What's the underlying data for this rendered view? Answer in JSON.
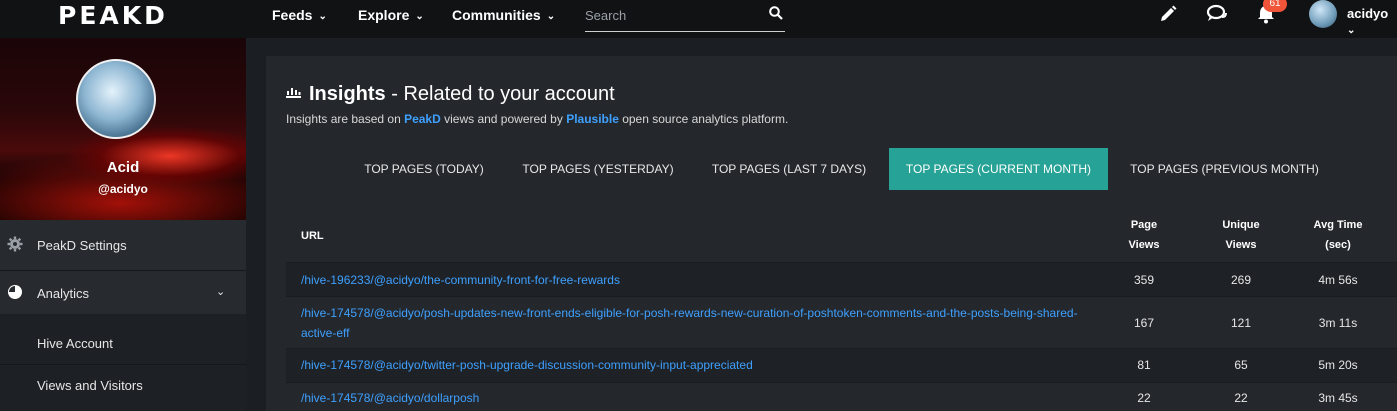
{
  "app": {
    "logo": "PEAKD"
  },
  "nav": {
    "feeds": "Feeds",
    "explore": "Explore",
    "communities": "Communities",
    "search_placeholder": "Search",
    "notifications_count": "61",
    "username": "acidyo"
  },
  "sidebar": {
    "display_name": "Acid",
    "handle": "@acidyo",
    "items": [
      {
        "label": "PeakD Settings",
        "icon": "gear-icon"
      },
      {
        "label": "Analytics",
        "icon": "pie-chart-icon"
      },
      {
        "label": "Hive Account"
      },
      {
        "label": "Views and Visitors"
      }
    ]
  },
  "insights": {
    "title_bold": "Insights",
    "title_rest": " - Related to your account",
    "subtitle_prefix": "Insights are based on ",
    "subtitle_link1": "PeakD",
    "subtitle_middle": " views and powered by ",
    "subtitle_link2": "Plausible",
    "subtitle_suffix": " open source analytics platform."
  },
  "tabs": [
    {
      "label": "TOP PAGES (TODAY)"
    },
    {
      "label": "TOP PAGES (YESTERDAY)"
    },
    {
      "label": "TOP PAGES (LAST 7 DAYS)"
    },
    {
      "label": "TOP PAGES (CURRENT MONTH)",
      "active": true
    },
    {
      "label": "TOP PAGES (PREVIOUS MONTH)"
    }
  ],
  "table": {
    "headers": {
      "url": "URL",
      "page_views_1": "Page",
      "page_views_2": "Views",
      "unique_views_1": "Unique",
      "unique_views_2": "Views",
      "avg_time_1": "Avg Time",
      "avg_time_2": "(sec)"
    },
    "rows": [
      {
        "url": "/hive-196233/@acidyo/the-community-front-for-free-rewards",
        "page_views": "359",
        "unique_views": "269",
        "avg_time": "4m 56s"
      },
      {
        "url": "/hive-174578/@acidyo/posh-updates-new-front-ends-eligible-for-posh-rewards-new-curation-of-poshtoken-comments-and-the-posts-being-shared-active-eff",
        "page_views": "167",
        "unique_views": "121",
        "avg_time": "3m 11s"
      },
      {
        "url": "/hive-174578/@acidyo/twitter-posh-upgrade-discussion-community-input-appreciated",
        "page_views": "81",
        "unique_views": "65",
        "avg_time": "5m 20s"
      },
      {
        "url": "/hive-174578/@acidyo/dollarposh",
        "page_views": "22",
        "unique_views": "22",
        "avg_time": "3m 45s"
      }
    ]
  },
  "colors": {
    "accent": "#27a296",
    "link": "#3ea0ff",
    "badge": "#f0553a"
  }
}
